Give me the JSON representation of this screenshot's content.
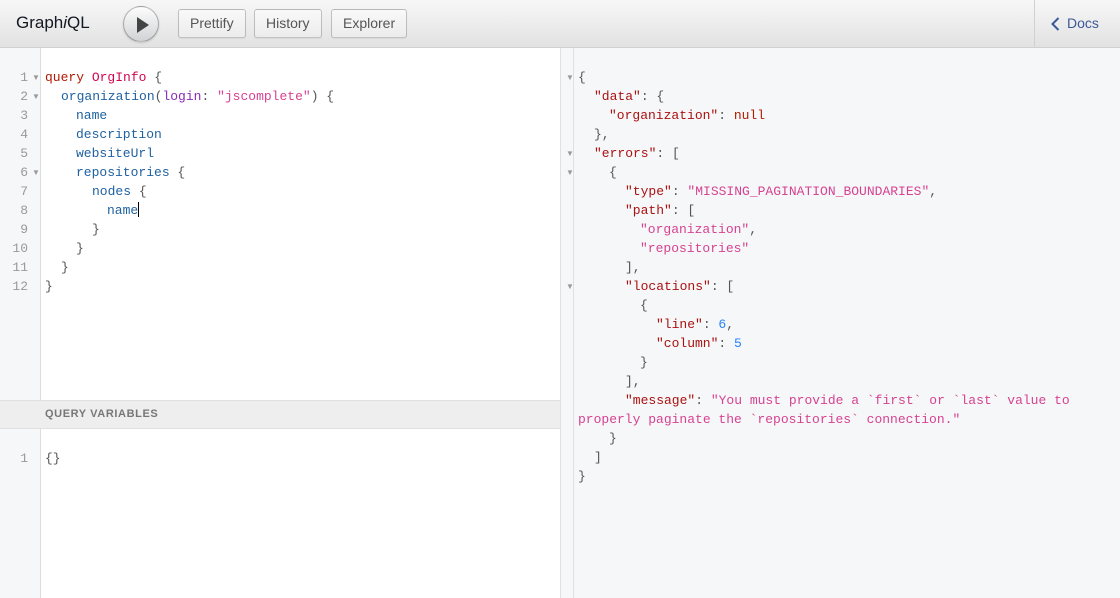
{
  "app": {
    "title_prefix": "Graph",
    "title_italic": "i",
    "title_suffix": "QL"
  },
  "toolbar": {
    "run_icon": "play-icon",
    "prettify_label": "Prettify",
    "history_label": "History",
    "explorer_label": "Explorer",
    "docs_label": "Docs",
    "docs_icon": "chevron-left-icon"
  },
  "query": {
    "line_numbers": [
      "1",
      "2",
      "3",
      "4",
      "5",
      "6",
      "7",
      "8",
      "9",
      "10",
      "11",
      "12"
    ],
    "l1_kw": "query",
    "l1_name": "OrgInfo",
    "l1_brace": "{",
    "l2_field": "organization",
    "l2_open": "(",
    "l2_arg": "login",
    "l2_colon": ": ",
    "l2_str": "\"jscomplete\"",
    "l2_close": ") {",
    "l3": "name",
    "l4": "description",
    "l5": "websiteUrl",
    "l6_field": "repositories",
    "l6_brace": " {",
    "l7_field": "nodes",
    "l7_brace": " {",
    "l8": "name",
    "l9": "}",
    "l10": "}",
    "l11": "}",
    "l12": "}"
  },
  "variables": {
    "header": "QUERY VARIABLES",
    "line_number": "1",
    "content": "{}"
  },
  "result": {
    "r1": "{",
    "r2_key": "\"data\"",
    "r2_rest": ": {",
    "r3_key": "\"organization\"",
    "r3_colon": ": ",
    "r3_val": "null",
    "r4": "},",
    "r5_key": "\"errors\"",
    "r5_rest": ": [",
    "r6": "{",
    "r7_key": "\"type\"",
    "r7_colon": ": ",
    "r7_val": "\"MISSING_PAGINATION_BOUNDARIES\"",
    "r7_comma": ",",
    "r8_key": "\"path\"",
    "r8_rest": ": [",
    "r9_val": "\"organization\"",
    "r9_comma": ",",
    "r10_val": "\"repositories\"",
    "r11": "],",
    "r12_key": "\"locations\"",
    "r12_rest": ": [",
    "r13": "{",
    "r14_key": "\"line\"",
    "r14_colon": ": ",
    "r14_val": "6",
    "r14_comma": ",",
    "r15_key": "\"column\"",
    "r15_colon": ": ",
    "r15_val": "5",
    "r16": "}",
    "r17": "],",
    "r18_key": "\"message\"",
    "r18_colon": ": ",
    "r18_val": "\"You must provide a `first` or `last` value to",
    "r19_val": "properly paginate the `repositories` connection.\"",
    "r20": "}",
    "r21": "]",
    "r22": "}"
  }
}
